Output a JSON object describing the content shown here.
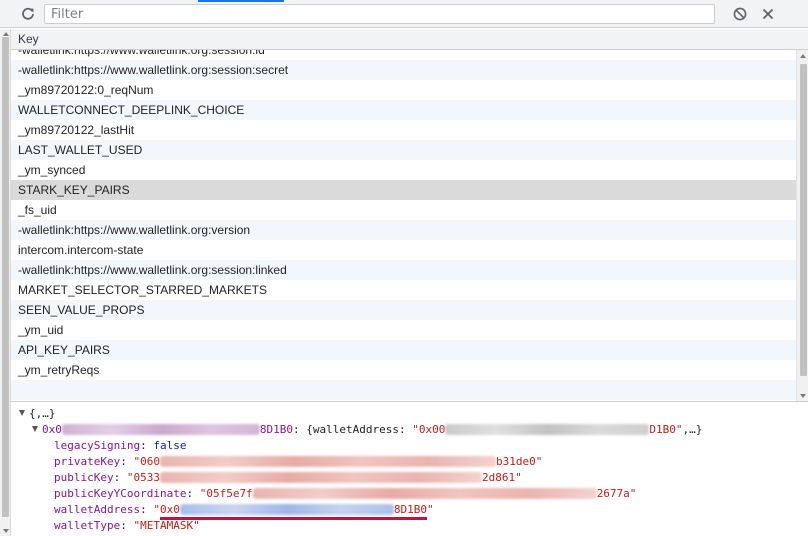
{
  "toolbar": {
    "filter_placeholder": "Filter",
    "icons": {
      "refresh": "refresh-icon",
      "clear_all": "clear-all-icon",
      "delete": "close-icon"
    }
  },
  "table": {
    "header": "Key",
    "rows": [
      "-walletlink:https://www.walletlink.org:session:id",
      "-walletlink:https://www.walletlink.org:session:secret",
      "_ym89720122:0_reqNum",
      "WALLETCONNECT_DEEPLINK_CHOICE",
      "_ym89720122_lastHit",
      "LAST_WALLET_USED",
      "_ym_synced",
      "STARK_KEY_PAIRS",
      "_fs_uid",
      "-walletlink:https://www.walletlink.org:version",
      "intercom.intercom-state",
      "-walletlink:https://www.walletlink.org:session:linked",
      "MARKET_SELECTOR_STARRED_MARKETS",
      "SEEN_VALUE_PROPS",
      "_ym_uid",
      "API_KEY_PAIRS",
      "_ym_retryReqs"
    ],
    "selected_key": "STARK_KEY_PAIRS"
  },
  "preview": {
    "root": "{,…}",
    "entry": {
      "key_prefix": "0x0",
      "key_suffix": "8D1B0",
      "summary_open": "{walletAddress: ",
      "summary_value_prefix": "\"0x00",
      "summary_value_suffix": "D1B0\"",
      "summary_close": ",…}"
    },
    "props": {
      "legacy_signing_key": "legacySigning",
      "legacy_signing_value": "false",
      "private_key_key": "privateKey",
      "private_key_prefix": "\"060",
      "private_key_suffix": "b31de0\"",
      "public_key_key": "publicKey",
      "public_key_prefix": "\"0533",
      "public_key_suffix": "2d861\"",
      "public_key_y_key": "publicKeyYCoordinate",
      "public_key_y_prefix": "\"05f5e7f",
      "public_key_y_suffix": "2677a\"",
      "wallet_address_key": "walletAddress",
      "wallet_address_quote": "\"",
      "wallet_address_prefix": "0x0",
      "wallet_address_suffix": "8D1B0",
      "wallet_address_end": "\"",
      "wallet_type_key": "walletType",
      "wallet_type_value": "\"METAMASK\""
    },
    "colon": ":",
    "colon_space": ": "
  }
}
